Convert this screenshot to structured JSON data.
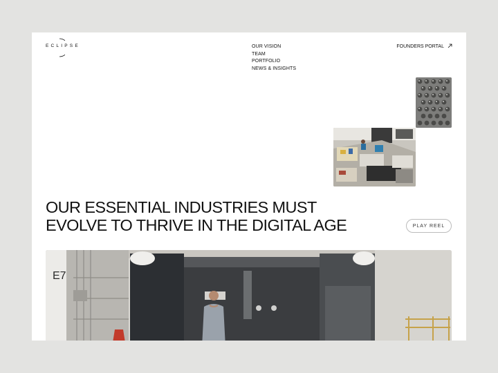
{
  "brand": {
    "name": "ECLIPSE"
  },
  "nav": {
    "items": [
      "OUR VISION",
      "TEAM",
      "PORTFOLIO",
      "NEWS & INSIGHTS"
    ],
    "portal_label": "FOUNDERS PORTAL",
    "portal_icon": "arrow-up-right-icon"
  },
  "hero": {
    "headline_line1": "OUR ESSENTIAL INDUSTRIES MUST",
    "headline_line2": "EVOLVE TO THRIVE IN THE DIGITAL AGE",
    "play_reel_label": "PLAY REEL",
    "marker_text": "E7"
  },
  "colors": {
    "page_bg": "#e3e3e1",
    "card_bg": "#ffffff",
    "text": "#111111"
  }
}
